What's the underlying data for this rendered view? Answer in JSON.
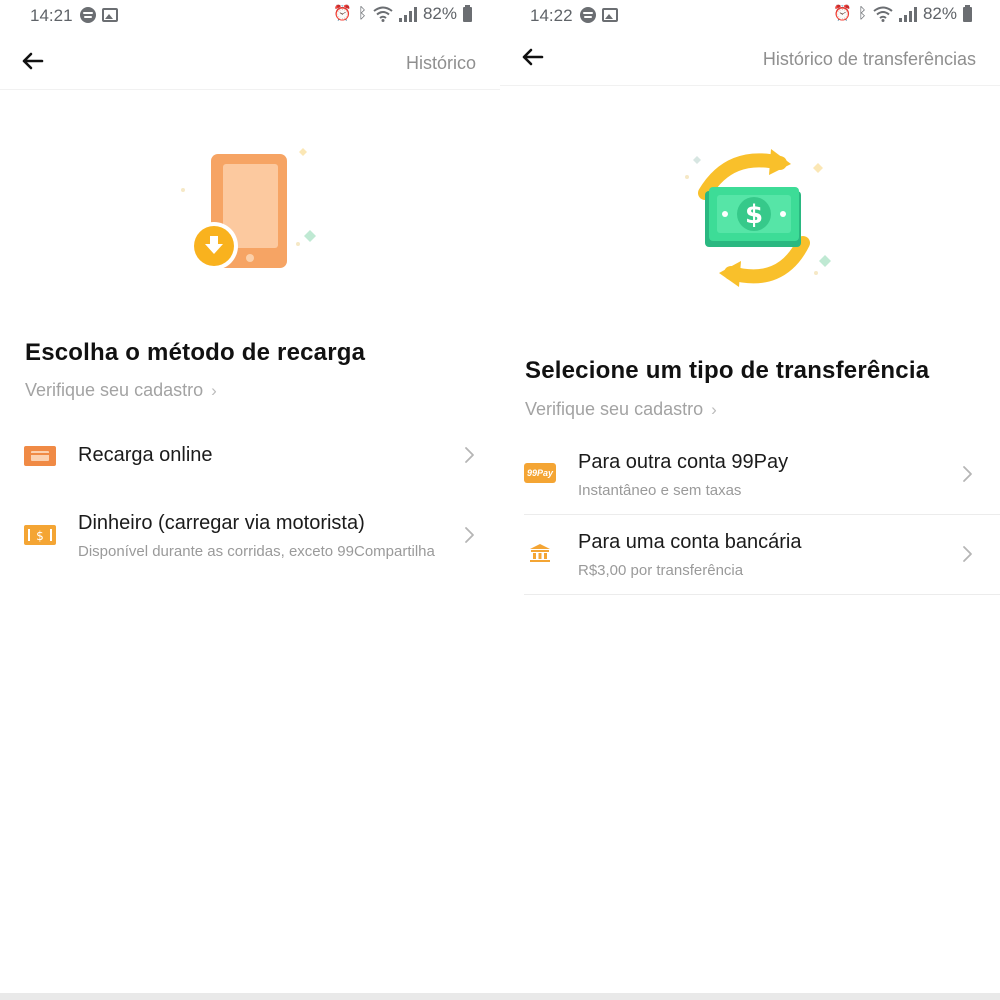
{
  "left_screen": {
    "status": {
      "time": "14:21",
      "battery": "82%"
    },
    "nav": {
      "action": "Histórico"
    },
    "title": "Escolha o método de recarga",
    "verify": "Verifique seu cadastro",
    "options": [
      {
        "icon": "card-icon",
        "title": "Recarga online",
        "subtitle": ""
      },
      {
        "icon": "cash-icon",
        "title": "Dinheiro (carregar via motorista)",
        "subtitle": "Disponível durante as corridas, exceto 99Compartilha"
      }
    ]
  },
  "right_screen": {
    "status": {
      "time": "14:22",
      "battery": "82%"
    },
    "nav": {
      "action": "Histórico de transferências"
    },
    "title": "Selecione um tipo de transferência",
    "verify": "Verifique seu cadastro",
    "options": [
      {
        "icon": "99pay-icon",
        "badge": "99Pay",
        "title": "Para outra conta 99Pay",
        "subtitle": "Instantâneo e sem taxas"
      },
      {
        "icon": "bank-icon",
        "title": "Para uma conta bancária",
        "subtitle": "R$3,00 por transferência"
      }
    ]
  },
  "colors": {
    "accent_orange": "#f4a534",
    "icon_orange": "#f08a45",
    "money_green": "#3ddc97",
    "divider": "#ececec"
  }
}
